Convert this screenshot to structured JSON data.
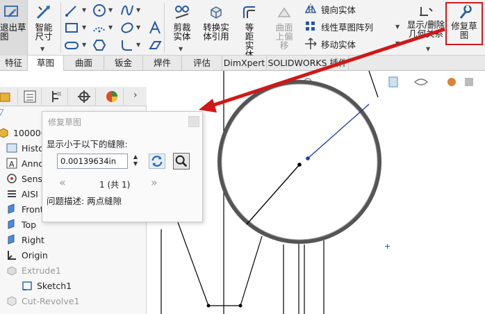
{
  "ribbon": {
    "exit_sketch": "退出草图",
    "smart_dimension": "智能尺寸",
    "trim": "剪裁实体",
    "convert": "转换实体引用",
    "offset": "等距实体",
    "surface_offset": "曲面上偏移",
    "mirror": "镜向实体",
    "linear_pattern": "线性草图阵列",
    "move": "移动实体",
    "show_delete": "显示/删除几何关系",
    "repair": "修复草图"
  },
  "tabs": [
    "特征",
    "草图",
    "曲面",
    "钣金",
    "焊件",
    "评估",
    "DimXpert",
    "SOLIDWORKS 插件"
  ],
  "active_tab": "草图",
  "tree": {
    "part": "10000094",
    "items": [
      "History",
      "Annotations",
      "Sensors",
      "AISI",
      "Front",
      "Top",
      "Right",
      "Origin",
      "Extrude1",
      "Sketch1",
      "Cut-Revolve1"
    ]
  },
  "dialog": {
    "title": "修复草图",
    "gap_label": "显示小于以下的缝隙:",
    "gap_value": "0.00139634in",
    "counter": "1 (共 1)",
    "description": "问题描述: 两点缝隙"
  },
  "colors": {
    "accent": "#d01818",
    "sketch_blue": "#1a3aa8"
  }
}
